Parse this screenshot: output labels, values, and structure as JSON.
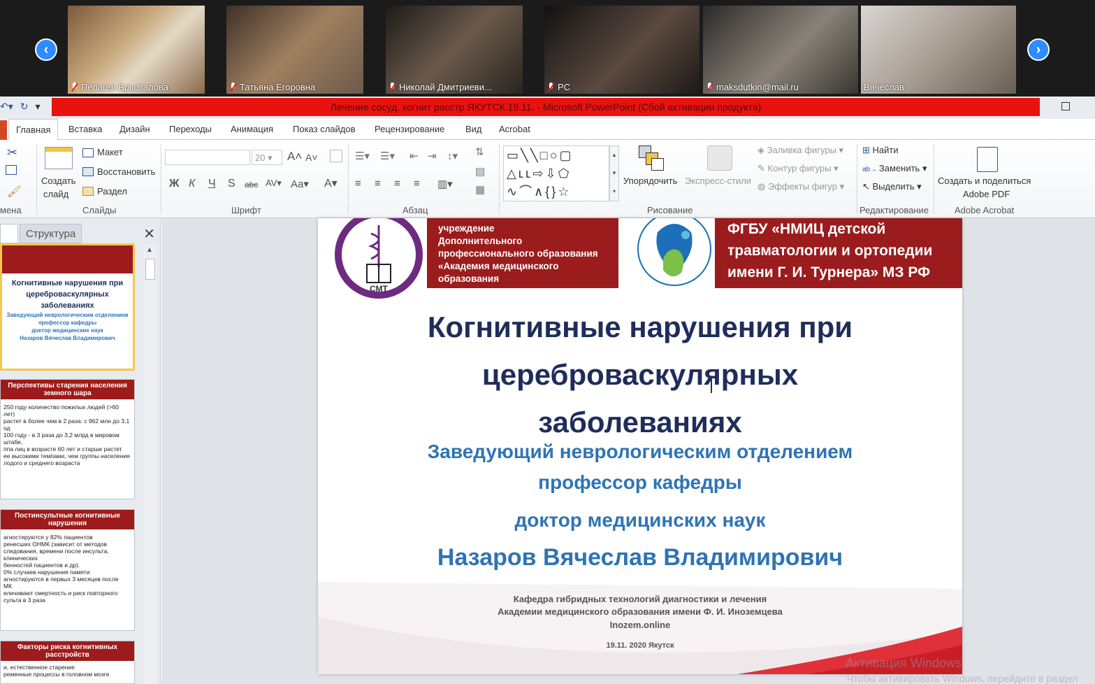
{
  "participants": [
    {
      "name": "Пелагея Брызгалова",
      "muted": true,
      "bg": "#8a6a4a"
    },
    {
      "name": "Татьяна Егоровна",
      "muted": true,
      "bg": "#6b5a4a"
    },
    {
      "name": "Николай Дмитриеви...",
      "muted": true,
      "bg": "#3a3530"
    },
    {
      "name": "PC",
      "muted": true,
      "bg": "#2a2624"
    },
    {
      "name": "maksdutkin@mail.ru",
      "muted": true,
      "bg": "#4a4640"
    },
    {
      "name": "Вячеслав",
      "muted": false,
      "bg": "#b8b4ae"
    }
  ],
  "window": {
    "title": "Лечение сосуд. когнит расстр ЯКУТСК 19.11.  -  Microsoft PowerPoint (Сбой активации продукта)"
  },
  "tabs": [
    "Главная",
    "Вставка",
    "Дизайн",
    "Переходы",
    "Анимация",
    "Показ слайдов",
    "Рецензирование",
    "Вид",
    "Acrobat"
  ],
  "ribbon": {
    "clipboard_label": "мена",
    "create_slide": "Создать",
    "create_slide2": "слайд",
    "layout": "Макет",
    "restore": "Восстановить",
    "section": "Раздел",
    "slides_label": "Слайды",
    "font_size": "20",
    "font_label": "Шрифт",
    "paragraph_label": "Абзац",
    "arrange": "Упорядочить",
    "quick_styles": "Экспресс-стили",
    "shape_fill": "Заливка фигуры",
    "shape_outline": "Контур фигуры",
    "shape_effects": "Эффекты фигур",
    "drawing_label": "Рисование",
    "find": "Найти",
    "replace": "Заменить",
    "select": "Выделить",
    "editing_label": "Редактирование",
    "adobe_create": "Создать и поделиться",
    "adobe_pdf": "Adobe PDF",
    "acrobat_label": "Adobe Acrobat"
  },
  "panel": {
    "tab_structure": "Структура",
    "thumbs": [
      {
        "header": "",
        "lines": [
          "Когнитивные нарушения при",
          "цереброваскулярных",
          "заболеваниях",
          "Заведующий неврологическим отделением",
          "профессор кафедры",
          "доктор медицинских наук",
          "Назаров Вячеслав Владимирович"
        ]
      },
      {
        "header": "Перспективы старения населения земного шара",
        "lines": [
          "250 году количество пожилых людей (>60 лет)",
          "растет в более чем в 2 раза: с 962 млн до 3,1",
          "од",
          "100 году - в 3 раза до 3,2 млрд в мировом",
          "штабе,",
          "ппа лиц в возрасте 60 лет и старше растет",
          "ее высокими темпами, чем группы населения",
          "лодого и среднего возраста"
        ]
      },
      {
        "header": "Постинсультные когнитивные нарушения",
        "lines": [
          "агностируются у 82% пациентов",
          "ренесших ОНМК (зависит от методов",
          "следования, времени после инсульта, клинических",
          "бенностей пациентов и др).",
          "0% случаев нарушения памяти",
          "агностируются в первых 3 месяцев после",
          "МК",
          "еличивают смертность и риск повторного",
          "сульта в 3 раза"
        ]
      },
      {
        "header": "Факторы риска когнитивных расстройств",
        "lines": [
          "и, естественное старение",
          "ременные процессы в головном мозге"
        ]
      }
    ]
  },
  "slide": {
    "org1": [
      "учреждение",
      "Дополнительного",
      "профессионального образования",
      "«Академия медицинского",
      "образования"
    ],
    "org2": [
      "ФГБУ «НМИЦ детской",
      "травматологии и ортопедии",
      "имени Г. И. Турнера» МЗ РФ"
    ],
    "title_lines": [
      "Когнитивные нарушения при",
      "цереброваскулярных",
      "заболеваниях"
    ],
    "sub1": "Заведующий неврологическим отделением",
    "sub2": "профессор кафедры",
    "sub3": "доктор медицинских наук",
    "name": "Назаров Вячеслав  Владимирович",
    "foot1": "Кафедра гибридных технологий диагностики и лечения",
    "foot2": "Академии медицинского образования имени Ф. И. Иноземцева",
    "foot3": "Inozem.online",
    "date": "19.11. 2020 Якутск",
    "logo_smt": "СМТ"
  },
  "watermark": {
    "line1": "Активация Windows",
    "line2": "Чтобы активировать Windows, перейдите в раздел"
  }
}
